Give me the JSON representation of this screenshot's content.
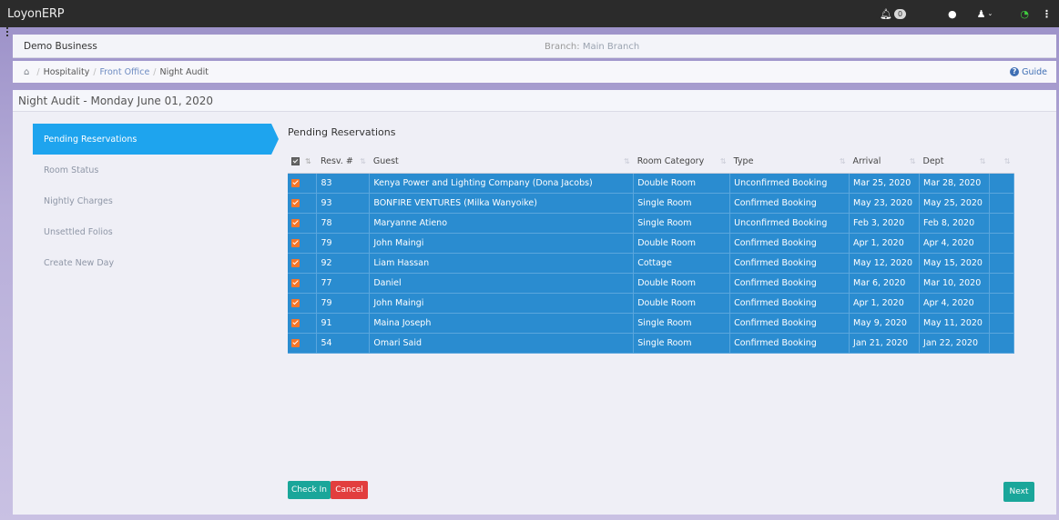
{
  "app": {
    "title": "LoyonERP"
  },
  "topbar": {
    "notification_count": "0"
  },
  "business": {
    "name": "Demo Business",
    "branch_label": "Branch:",
    "branch_value": "Main Branch"
  },
  "breadcrumb": {
    "items": [
      "Hospitality",
      "Front Office",
      "Night Audit"
    ],
    "guide_label": "Guide"
  },
  "page": {
    "title": "Night Audit - Monday June 01, 2020"
  },
  "side_nav": {
    "items": [
      {
        "label": "Pending Reservations",
        "active": true
      },
      {
        "label": "Room Status",
        "active": false
      },
      {
        "label": "Nightly Charges",
        "active": false
      },
      {
        "label": "Unsettled Folios",
        "active": false
      },
      {
        "label": "Create New Day",
        "active": false
      }
    ]
  },
  "table": {
    "title": "Pending Reservations",
    "headers": [
      "Resv. #",
      "Guest",
      "Room Category",
      "Type",
      "Arrival",
      "Dept"
    ],
    "rows": [
      {
        "resv": "83",
        "guest": "Kenya Power and Lighting Company (Dona Jacobs)",
        "room": "Double Room",
        "type": "Unconfirmed Booking",
        "arrival": "Mar 25, 2020",
        "dept": "Mar 28, 2020"
      },
      {
        "resv": "93",
        "guest": "BONFIRE VENTURES (Milka Wanyoike)",
        "room": "Single Room",
        "type": "Confirmed Booking",
        "arrival": "May 23, 2020",
        "dept": "May 25, 2020"
      },
      {
        "resv": "78",
        "guest": "Maryanne Atieno",
        "room": "Single Room",
        "type": "Unconfirmed Booking",
        "arrival": "Feb 3, 2020",
        "dept": "Feb 8, 2020"
      },
      {
        "resv": "79",
        "guest": "John Maingi",
        "room": "Double Room",
        "type": "Confirmed Booking",
        "arrival": "Apr 1, 2020",
        "dept": "Apr 4, 2020"
      },
      {
        "resv": "92",
        "guest": "Liam Hassan",
        "room": "Cottage",
        "type": "Confirmed Booking",
        "arrival": "May 12, 2020",
        "dept": "May 15, 2020"
      },
      {
        "resv": "77",
        "guest": "Daniel",
        "room": "Double Room",
        "type": "Confirmed Booking",
        "arrival": "Mar 6, 2020",
        "dept": "Mar 10, 2020"
      },
      {
        "resv": "79",
        "guest": "John Maingi",
        "room": "Double Room",
        "type": "Confirmed Booking",
        "arrival": "Apr 1, 2020",
        "dept": "Apr 4, 2020"
      },
      {
        "resv": "91",
        "guest": "Maina Joseph",
        "room": "Single Room",
        "type": "Confirmed Booking",
        "arrival": "May 9, 2020",
        "dept": "May 11, 2020"
      },
      {
        "resv": "54",
        "guest": "Omari Said",
        "room": "Single Room",
        "type": "Confirmed Booking",
        "arrival": "Jan 21, 2020",
        "dept": "Jan 22, 2020"
      }
    ]
  },
  "actions": {
    "check_in": "Check In",
    "cancel": "Cancel",
    "next": "Next"
  },
  "colors": {
    "topbar": "#2b2b2b",
    "active_nav": "#1ea4ee",
    "row_bg": "#2a8cd0",
    "checkbox": "#f5762a",
    "teal_button": "#1aa69a",
    "red_button": "#e23e3e"
  }
}
